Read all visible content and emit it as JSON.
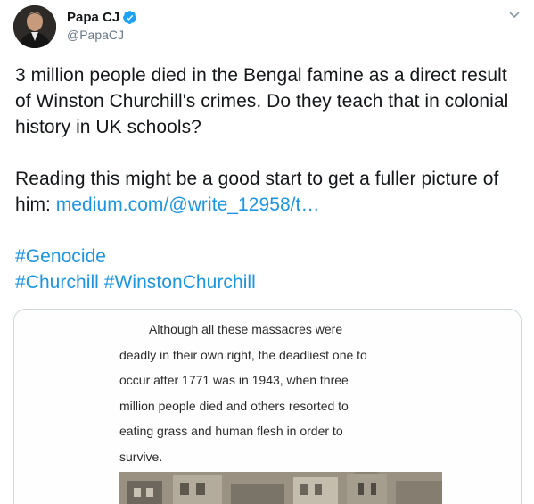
{
  "author": {
    "display_name": "Papa CJ",
    "handle": "@PapaCJ",
    "verified": true,
    "avatar_icon": "profile-photo",
    "verified_icon": "verified-badge-icon",
    "verified_color": "#1da1f2"
  },
  "tweet": {
    "paragraph1": "3 million people died in the Bengal famine as a direct result of Winston Churchill's crimes. Do they teach that in colonial history in UK schools?",
    "paragraph2_text": "Reading this might be a good start to get a fuller picture of him: ",
    "paragraph2_link": "medium.com/@write_12958/t…",
    "hashtag_genocide": "#Genocide",
    "hashtag_churchill": "#Churchill",
    "hashtag_winstonchurchill": "#WinstonChurchill",
    "link_color": "#1b95e0"
  },
  "media_card": {
    "excerpt_lines": [
      "Although all these massacres were",
      "deadly in their own right, the deadliest one to",
      "occur after 1771 was in 1943, when three",
      "million people died and others resorted to",
      "eating grass and human flesh in order to",
      "survive."
    ],
    "photo_icon": "archival-photo"
  },
  "menu": {
    "caret_icon": "chevron-down-icon"
  }
}
